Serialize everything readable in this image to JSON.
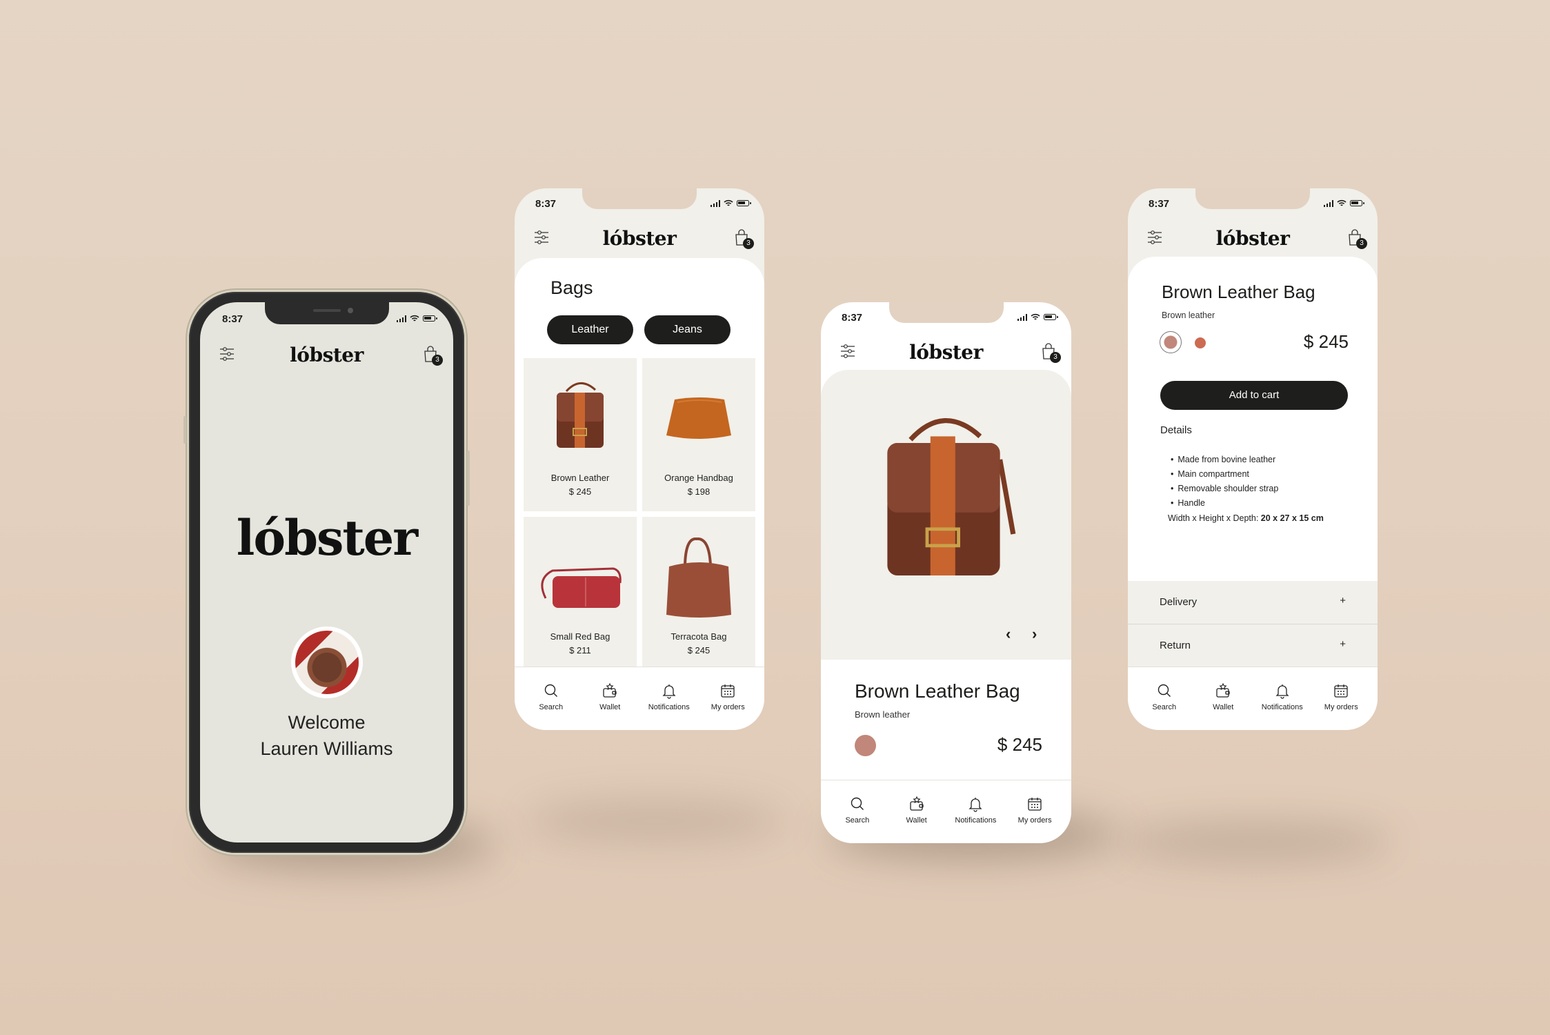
{
  "status": {
    "time": "8:37"
  },
  "brand": {
    "logo": "lóbster",
    "cart_count": "3"
  },
  "tabbar": [
    {
      "label": "Search",
      "icon": "search-icon"
    },
    {
      "label": "Wallet",
      "icon": "wallet-icon"
    },
    {
      "label": "Notifications",
      "icon": "bell-icon"
    },
    {
      "label": "My orders",
      "icon": "calendar-icon"
    }
  ],
  "welcome": {
    "greeting": "Welcome",
    "user_name": "Lauren Williams"
  },
  "catalog": {
    "title": "Bags",
    "filters": [
      "Leather",
      "Jeans"
    ],
    "products": [
      {
        "name": "Brown Leather",
        "price": "$ 245",
        "color": "#6e3422"
      },
      {
        "name": "Orange Handbag",
        "price": "$ 198",
        "color": "#c4661f"
      },
      {
        "name": "Small Red Bag",
        "price": "$ 211",
        "color": "#b8343a"
      },
      {
        "name": "Terracota Bag",
        "price": "$ 245",
        "color": "#9a4e38"
      }
    ]
  },
  "product": {
    "title": "Brown Leather Bag",
    "subtitle": "Brown leather",
    "price": "$ 245",
    "swatches": [
      "#c0877a",
      "#cd6a52"
    ],
    "prev": "‹",
    "next": "›",
    "add_to_cart": "Add to cart",
    "details_heading": "Details",
    "details": [
      "Made from bovine leather",
      "Main compartment",
      "Removable shoulder strap",
      "Handle"
    ],
    "dimensions_label": "Width x Height x Depth:",
    "dimensions_value": "20 x 27 x 15 cm",
    "accordions": [
      {
        "label": "Delivery",
        "toggle": "+"
      },
      {
        "label": "Return",
        "toggle": "+"
      }
    ]
  }
}
